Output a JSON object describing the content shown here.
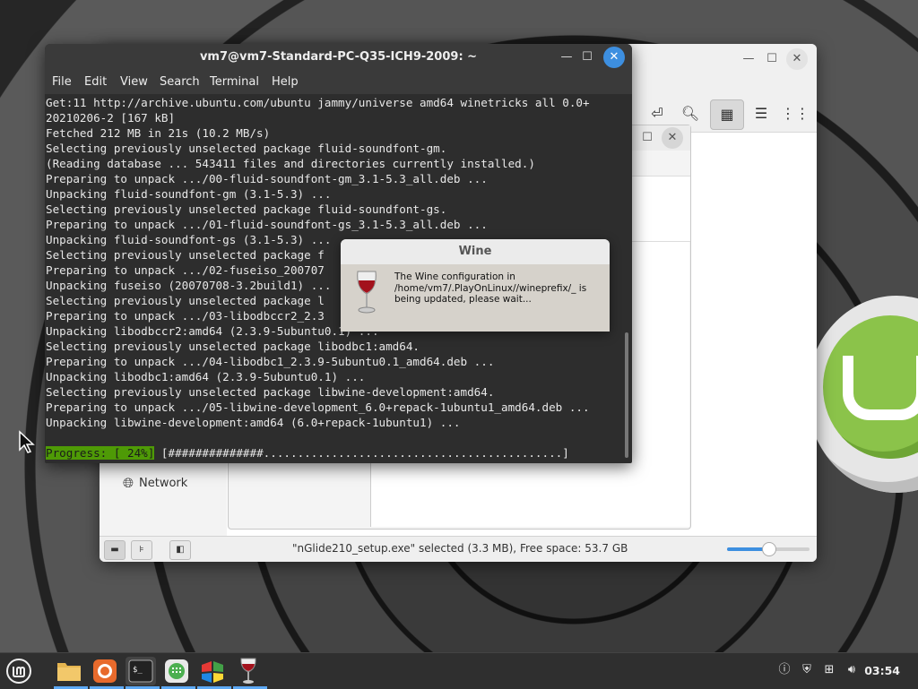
{
  "terminal": {
    "title": "vm7@vm7-Standard-PC-Q35-ICH9-2009: ~",
    "menu": [
      "File",
      "Edit",
      "View",
      "Search",
      "Terminal",
      "Help"
    ],
    "lines": [
      "Get:11 http://archive.ubuntu.com/ubuntu jammy/universe amd64 winetricks all 0.0+",
      "20210206-2 [167 kB]",
      "Fetched 212 MB in 21s (10.2 MB/s)",
      "Selecting previously unselected package fluid-soundfont-gm.",
      "(Reading database ... 543411 files and directories currently installed.)",
      "Preparing to unpack .../00-fluid-soundfont-gm_3.1-5.3_all.deb ...",
      "Unpacking fluid-soundfont-gm (3.1-5.3) ...",
      "Selecting previously unselected package fluid-soundfont-gs.",
      "Preparing to unpack .../01-fluid-soundfont-gs_3.1-5.3_all.deb ...",
      "Unpacking fluid-soundfont-gs (3.1-5.3) ...",
      "Selecting previously unselected package f",
      "Preparing to unpack .../02-fuseiso_200707",
      "Unpacking fuseiso (20070708-3.2build1) ...",
      "Selecting previously unselected package l",
      "Preparing to unpack .../03-libodbccr2_2.3",
      "Unpacking libodbccr2:amd64 (2.3.9-5ubuntu0.1) ...",
      "Selecting previously unselected package libodbc1:amd64.",
      "Preparing to unpack .../04-libodbc1_2.3.9-5ubuntu0.1_amd64.deb ...",
      "Unpacking libodbc1:amd64 (2.3.9-5ubuntu0.1) ...",
      "Selecting previously unselected package libwine-development:amd64.",
      "Preparing to unpack .../05-libwine-development_6.0+repack-1ubuntu1_amd64.deb ...",
      "Unpacking libwine-development:amd64 (6.0+repack-1ubuntu1) ..."
    ],
    "progress_label": "Progress: [ 24%]",
    "progress_bar": "[##############............................................]"
  },
  "wine_dialog": {
    "title": "Wine",
    "message": "The Wine configuration in /home/vm7/.PlayOnLinux//wineprefix/_ is being updated, please wait..."
  },
  "file_manager": {
    "sidebar_partial": "Network",
    "sidebar_network": "Network",
    "status_text": "\"nGlide210_setup.exe\" selected (3.3 MB), Free space: 53.7 GB",
    "zoom_fraction": 0.5
  },
  "taskbar": {
    "clock": "03:54"
  }
}
